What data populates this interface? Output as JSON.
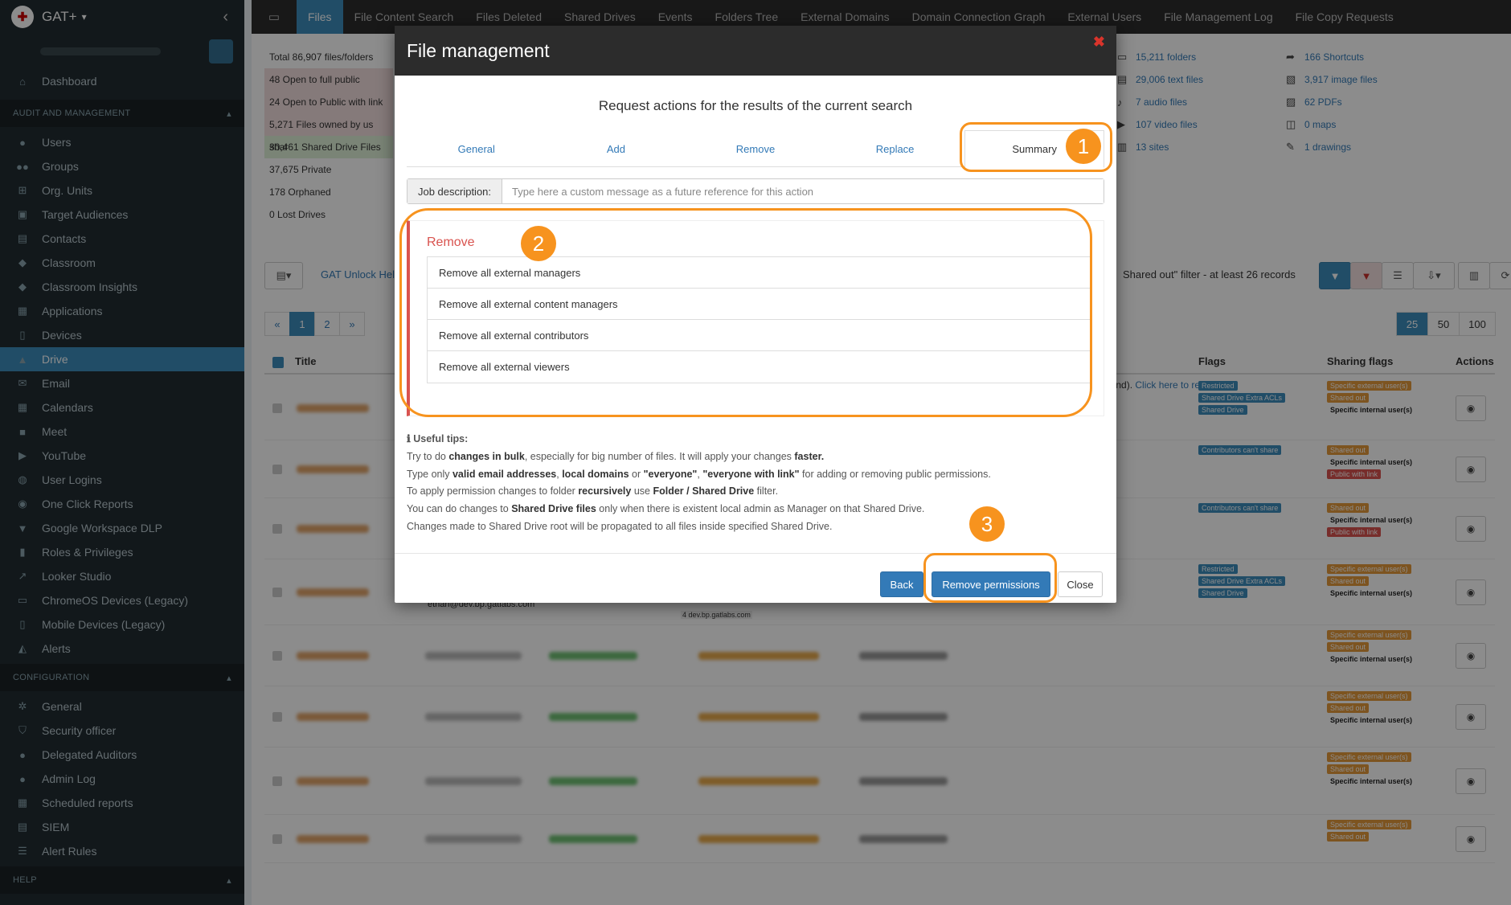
{
  "app": {
    "brand": "GAT+",
    "collapse_icon": "chevron-left-icon"
  },
  "sidebar": {
    "dashboard": "Dashboard",
    "section_audit": "AUDIT AND MANAGEMENT",
    "audit_items": [
      {
        "label": "Users",
        "icon": "user-icon"
      },
      {
        "label": "Groups",
        "icon": "users-icon"
      },
      {
        "label": "Org. Units",
        "icon": "sitemap-icon"
      },
      {
        "label": "Target Audiences",
        "icon": "id-card-icon"
      },
      {
        "label": "Contacts",
        "icon": "address-book-icon"
      },
      {
        "label": "Classroom",
        "icon": "graduation-cap-icon"
      },
      {
        "label": "Classroom Insights",
        "icon": "graduation-cap-icon"
      },
      {
        "label": "Applications",
        "icon": "grid-icon"
      },
      {
        "label": "Devices",
        "icon": "mobile-icon"
      },
      {
        "label": "Drive",
        "icon": "drive-icon"
      },
      {
        "label": "Email",
        "icon": "envelope-icon"
      },
      {
        "label": "Calendars",
        "icon": "calendar-icon"
      },
      {
        "label": "Meet",
        "icon": "video-icon"
      },
      {
        "label": "YouTube",
        "icon": "youtube-icon"
      },
      {
        "label": "User Logins",
        "icon": "globe-icon"
      },
      {
        "label": "One Click Reports",
        "icon": "eye-icon"
      },
      {
        "label": "Google Workspace DLP",
        "icon": "filter-icon"
      },
      {
        "label": "Roles & Privileges",
        "icon": "lock-icon"
      },
      {
        "label": "Looker Studio",
        "icon": "chart-icon"
      },
      {
        "label": "ChromeOS Devices (Legacy)",
        "icon": "laptop-icon"
      },
      {
        "label": "Mobile Devices (Legacy)",
        "icon": "mobile-icon"
      },
      {
        "label": "Alerts",
        "icon": "bell-icon"
      }
    ],
    "section_config": "CONFIGURATION",
    "config_items": [
      {
        "label": "General",
        "icon": "gears-icon"
      },
      {
        "label": "Security officer",
        "icon": "shield-icon"
      },
      {
        "label": "Delegated Auditors",
        "icon": "user-secret-icon"
      },
      {
        "label": "Admin Log",
        "icon": "user-icon"
      },
      {
        "label": "Scheduled reports",
        "icon": "calendar-icon"
      },
      {
        "label": "SIEM",
        "icon": "server-icon"
      },
      {
        "label": "Alert Rules",
        "icon": "list-icon"
      }
    ],
    "section_help": "HELP"
  },
  "topbar": {
    "tabs": [
      "Files",
      "File Content Search",
      "Files Deleted",
      "Shared Drives",
      "Events",
      "Folders Tree",
      "External Domains",
      "Domain Connection Graph",
      "External Users",
      "File Management Log",
      "File Copy Requests"
    ],
    "active_tab": "Files"
  },
  "stats_left": [
    {
      "label": "Total 86,907 files/folders",
      "tone": "none"
    },
    {
      "label": "48 Open to full public",
      "tone": "pink"
    },
    {
      "label": "24 Open to Public with link",
      "tone": "pink"
    },
    {
      "label": "5,271 Files owned by us shar",
      "tone": "pink"
    },
    {
      "label": "30,461 Shared Drive Files",
      "tone": "green"
    },
    {
      "label": "37,675 Private",
      "tone": "none"
    },
    {
      "label": "178 Orphaned",
      "tone": "none"
    },
    {
      "label": "0 Lost Drives",
      "tone": "none"
    }
  ],
  "stats_right": [
    {
      "label": "15,211 folders",
      "icon": "folder-icon"
    },
    {
      "label": "166 Shortcuts",
      "icon": "share-icon"
    },
    {
      "label": "29,006 text files",
      "icon": "file-text-icon"
    },
    {
      "label": "3,917 image files",
      "icon": "file-image-icon"
    },
    {
      "label": "7 audio files",
      "icon": "file-audio-icon"
    },
    {
      "label": "62 PDFs",
      "icon": "file-pdf-icon"
    },
    {
      "label": "107 video files",
      "icon": "file-video-icon"
    },
    {
      "label": "0 maps",
      "icon": "map-icon"
    },
    {
      "label": "13 sites",
      "icon": "sites-icon"
    },
    {
      "label": "1 drawings",
      "icon": "drawing-icon"
    }
  ],
  "toolbar": {
    "help_link": "GAT Unlock Help",
    "filter_text": "Shared out\" filter -   at least 26 records"
  },
  "pager": {
    "prev": "«",
    "pages": [
      "1",
      "2"
    ],
    "next": "»",
    "sizes": [
      "25",
      "50",
      "100"
    ],
    "active_size": "25"
  },
  "table": {
    "headers": {
      "title": "Title",
      "flags": "Flags",
      "sharing": "Sharing flags",
      "actions": "Actions"
    },
    "refresh_note": "ound). ",
    "refresh_link": "Click here to refresh.",
    "visible_owner": "ethan@dev.bp.gatlabs.com",
    "visible_domain": "4 dev.bp.gatlabs.com",
    "rows": [
      {
        "flags": [
          "Restricted",
          "Shared Drive Extra ACLs",
          "Shared Drive"
        ],
        "sharing": [
          "Specific external user(s)",
          "Shared out",
          "Specific internal user(s)"
        ]
      },
      {
        "flags": [
          "Contributors can't share"
        ],
        "sharing": [
          "Shared out",
          "Specific internal user(s)",
          "Public with link"
        ]
      },
      {
        "flags": [
          "Contributors can't share"
        ],
        "sharing": [
          "Shared out",
          "Specific internal user(s)",
          "Public with link"
        ]
      },
      {
        "flags": [
          "Restricted",
          "Shared Drive Extra ACLs",
          "Shared Drive"
        ],
        "sharing": [
          "Specific external user(s)",
          "Shared out",
          "Specific internal user(s)"
        ]
      },
      {
        "flags": [],
        "sharing": [
          "Specific external user(s)",
          "Shared out",
          "Specific internal user(s)"
        ]
      },
      {
        "flags": [],
        "sharing": [
          "Specific external user(s)",
          "Shared out",
          "Specific internal user(s)"
        ]
      },
      {
        "flags": [],
        "sharing": [
          "Specific external user(s)",
          "Shared out",
          "Specific internal user(s)"
        ]
      },
      {
        "flags": [],
        "sharing": [
          "Specific external user(s)",
          "Shared out"
        ]
      }
    ]
  },
  "modal": {
    "title": "File management",
    "subtitle": "Request actions for the results of the current search",
    "tabs": [
      "General",
      "Add",
      "Remove",
      "Replace",
      "Summary"
    ],
    "active_tab": "Summary",
    "job_label": "Job description:",
    "job_placeholder": "Type here a custom message as a future reference for this action",
    "remove_title": "Remove",
    "remove_items": [
      "Remove all external managers",
      "Remove all external content managers",
      "Remove all external contributors",
      "Remove all external viewers"
    ],
    "tips_head": "Useful tips:",
    "tip1_a": "Try to do ",
    "tip1_b": "changes in bulk",
    "tip1_c": ", especially for big number of files. It will apply your changes ",
    "tip1_d": "faster.",
    "tip2_a": "Type only ",
    "tip2_b": "valid email addresses",
    "tip2_c": ", ",
    "tip2_d": "local domains",
    "tip2_e": " or ",
    "tip2_f": "\"everyone\"",
    "tip2_g": ", ",
    "tip2_h": "\"everyone with link\"",
    "tip2_i": " for adding or removing public permissions.",
    "tip3_a": "To apply permission changes to folder ",
    "tip3_b": "recursively",
    "tip3_c": " use ",
    "tip3_d": "Folder / Shared Drive",
    "tip3_e": " filter.",
    "tip4_a": "You can do changes to ",
    "tip4_b": "Shared Drive files",
    "tip4_c": " only when there is existent local admin as Manager on that Shared Drive.",
    "tip5": "Changes made to Shared Drive root will be propagated to all files inside specified Shared Drive.",
    "back": "Back",
    "remove_permissions": "Remove permissions",
    "close": "Close"
  },
  "callouts": [
    "1",
    "2",
    "3"
  ],
  "colors": {
    "accent": "#3c8dbc",
    "callout": "#f7931e",
    "danger": "#d9534f",
    "sidebar": "#222d32"
  }
}
